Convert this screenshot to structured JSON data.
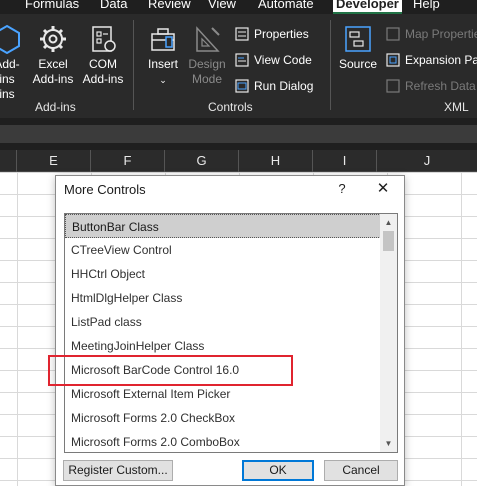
{
  "ribbon_tabs": [
    "Formulas",
    "Data",
    "Review",
    "View",
    "Automate",
    "Developer",
    "Help"
  ],
  "active_tab": "Developer",
  "addins_group": {
    "label": "Add-ins",
    "addins_partial": "Add-ins",
    "addins_partial_line2": "ins",
    "excel_addins": "Excel",
    "excel_addins_line2": "Add-ins",
    "com_addins": "COM",
    "com_addins_line2": "Add-ins"
  },
  "controls_group": {
    "label": "Controls",
    "insert": "Insert",
    "design_mode": "Design",
    "design_mode_line2": "Mode",
    "properties": "Properties",
    "view_code": "View Code",
    "run_dialog": "Run Dialog"
  },
  "xml_group": {
    "label": "XML",
    "source": "Source",
    "map_properties": "Map Properties",
    "expansion_packs": "Expansion Packs",
    "refresh_data": "Refresh Data"
  },
  "columns": [
    "E",
    "F",
    "G",
    "H",
    "I",
    "J"
  ],
  "dialog": {
    "title": "More Controls",
    "help": "?",
    "close": "✕",
    "items": [
      "ButtonBar Class",
      "CTreeView Control",
      "HHCtrl Object",
      "HtmlDlgHelper Class",
      "ListPad class",
      "MeetingJoinHelper Class",
      "Microsoft BarCode Control 16.0",
      "Microsoft External Item Picker",
      "Microsoft Forms 2.0 CheckBox",
      "Microsoft Forms 2.0 ComboBox"
    ],
    "selected_index": 0,
    "highlighted_index": 6,
    "register_button": "Register Custom...",
    "ok_button": "OK",
    "cancel_button": "Cancel"
  },
  "colors": {
    "ribbon_bg": "#2a2a2a",
    "accent_green": "#217346",
    "highlight_red": "#e0242f",
    "default_button_border": "#0078d7"
  }
}
